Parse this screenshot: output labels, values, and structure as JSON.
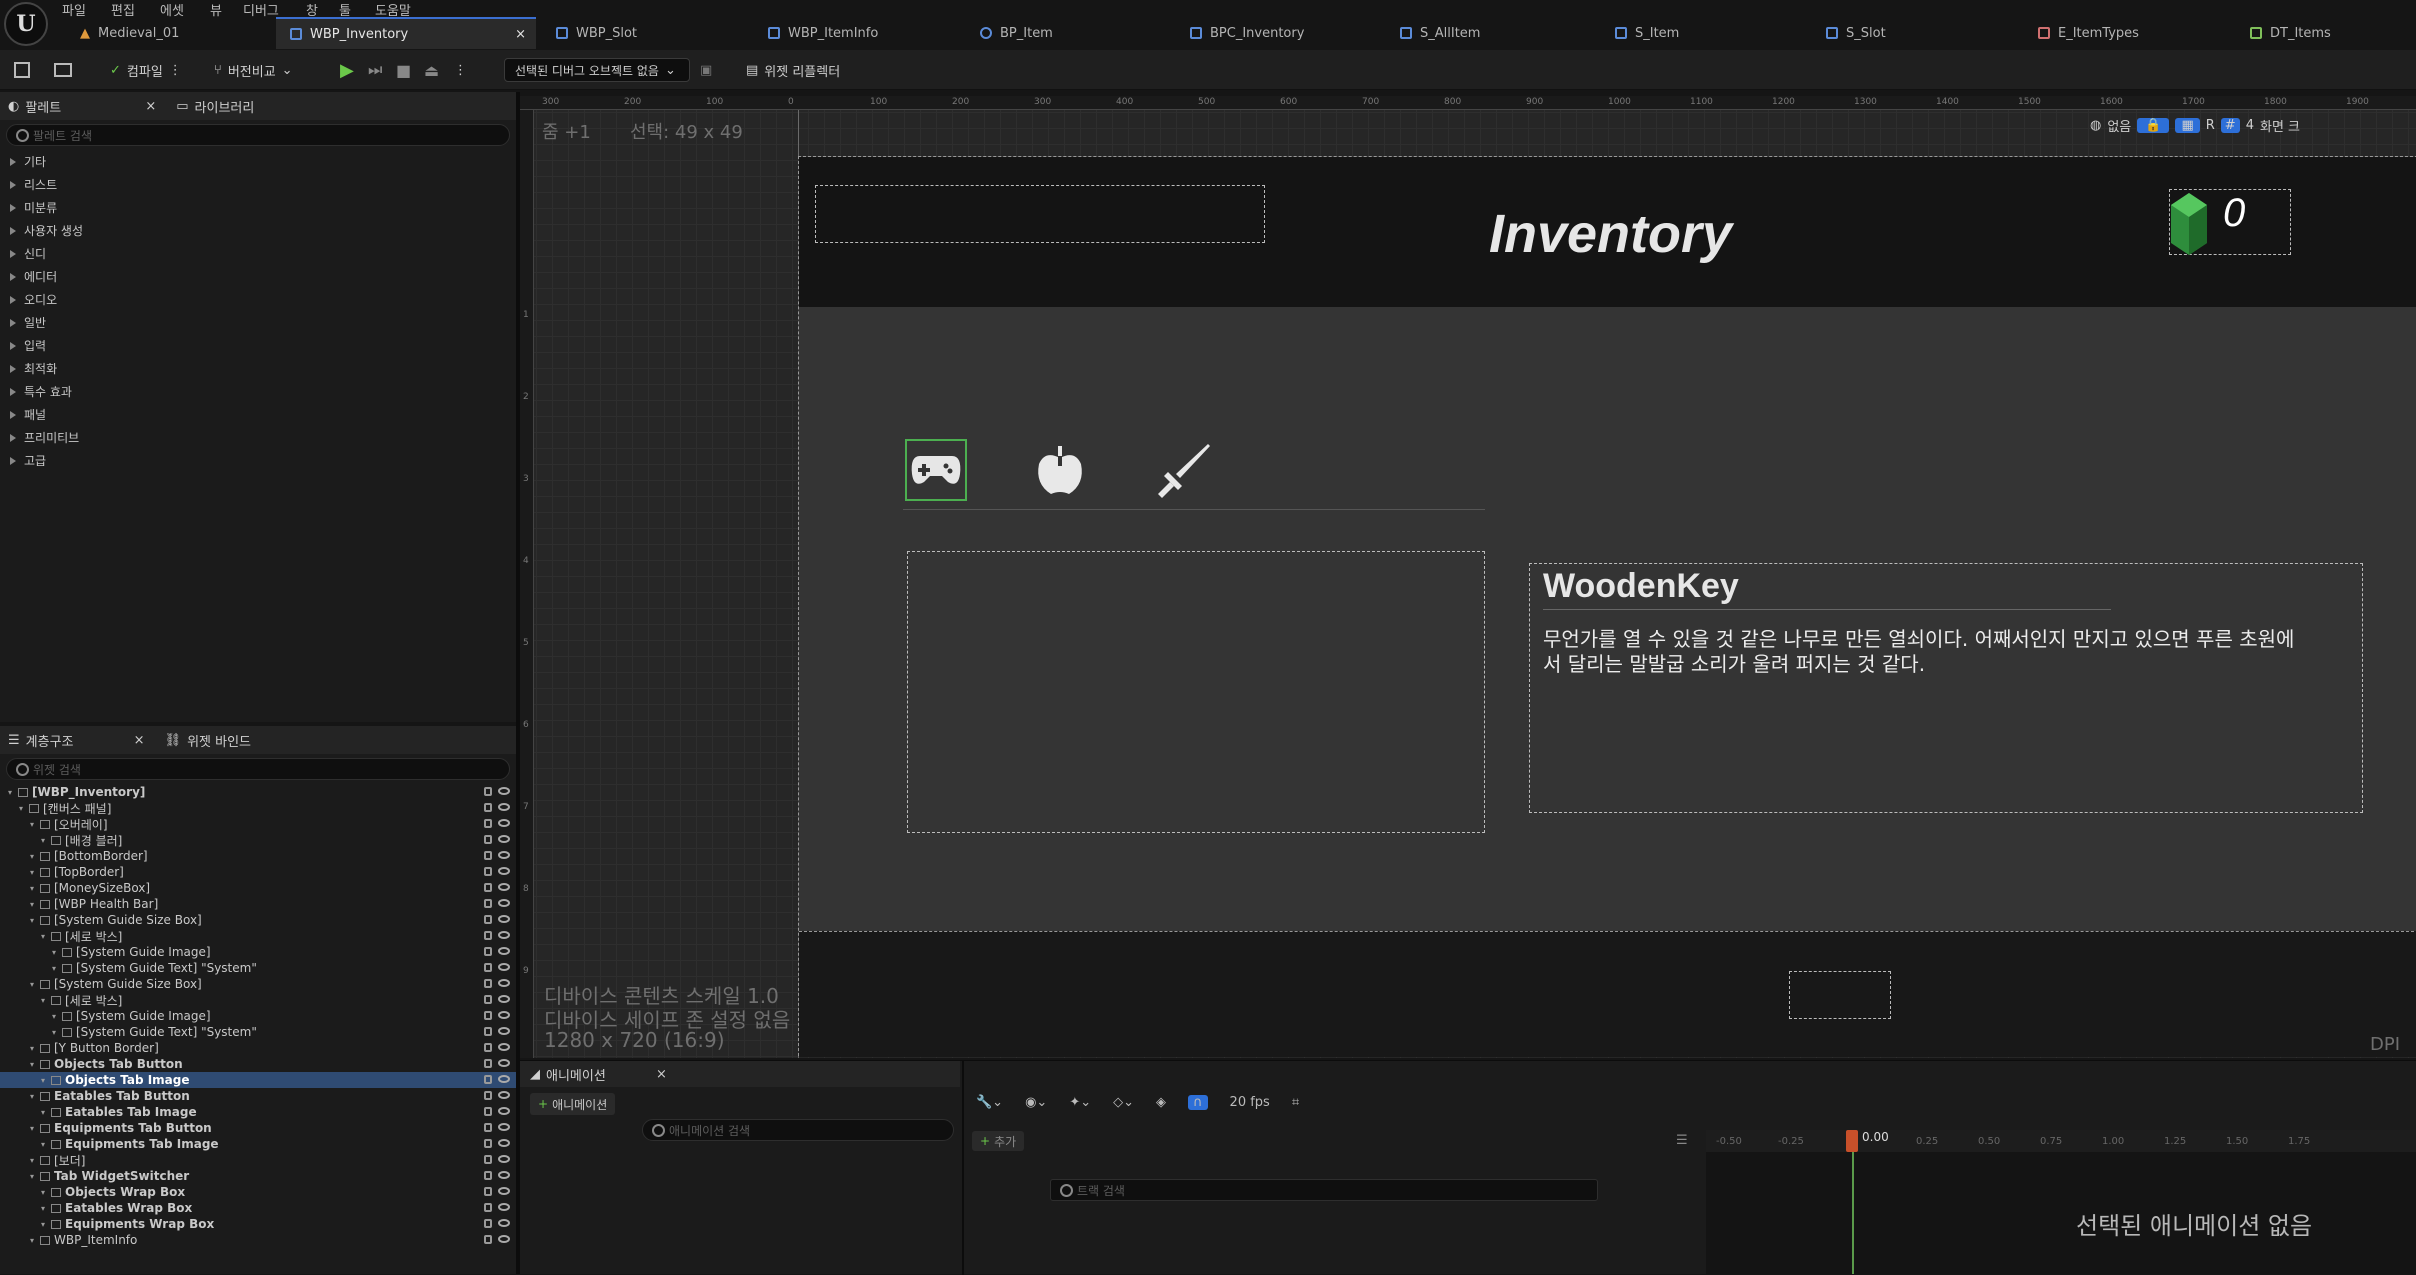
{
  "menu": [
    "파일",
    "편집",
    "에셋",
    "뷰",
    "디버그",
    "창",
    "툴",
    "도움말"
  ],
  "tabs": [
    {
      "label": "Medieval_01",
      "active": false
    },
    {
      "label": "WBP_Inventory",
      "active": true
    },
    {
      "label": "WBP_Slot",
      "active": false
    },
    {
      "label": "WBP_ItemInfo",
      "active": false
    },
    {
      "label": "BP_Item",
      "active": false
    },
    {
      "label": "BPC_Inventory",
      "active": false
    },
    {
      "label": "S_AllItem",
      "active": false
    },
    {
      "label": "S_Item",
      "active": false
    },
    {
      "label": "S_Slot",
      "active": false
    },
    {
      "label": "E_ItemTypes",
      "active": false
    },
    {
      "label": "DT_Items",
      "active": false
    }
  ],
  "toolbar": {
    "compile": "컴파일",
    "diff": "버전비교",
    "debug_object": "선택된 디버그 오브젝트 없음",
    "reflector": "위젯 리플렉터"
  },
  "palette": {
    "title": "팔레트",
    "library": "라이브러리",
    "search_placeholder": "팔레트 검색",
    "categories": [
      "기타",
      "리스트",
      "미분류",
      "사용자 생성",
      "신디",
      "에디터",
      "오디오",
      "일반",
      "입력",
      "최적화",
      "특수 효과",
      "패널",
      "프리미티브",
      "고급"
    ]
  },
  "hierarchy": {
    "title": "계층구조",
    "bindings": "위젯 바인드",
    "search_placeholder": "위젯 검색",
    "rows": [
      {
        "label": "[WBP_Inventory]",
        "indent": 0,
        "bold": true
      },
      {
        "label": "[캔버스 패널]",
        "indent": 1,
        "bold": false
      },
      {
        "label": "[오버레이]",
        "indent": 2,
        "bold": false
      },
      {
        "label": "[배경 블러]",
        "indent": 3,
        "bold": false
      },
      {
        "label": "[BottomBorder]",
        "indent": 2,
        "bold": false
      },
      {
        "label": "[TopBorder]",
        "indent": 2,
        "bold": false
      },
      {
        "label": "[MoneySizeBox]",
        "indent": 2,
        "bold": false
      },
      {
        "label": "[WBP Health Bar]",
        "indent": 2,
        "bold": false
      },
      {
        "label": "[System Guide Size Box]",
        "indent": 2,
        "bold": false
      },
      {
        "label": "[세로 박스]",
        "indent": 3,
        "bold": false
      },
      {
        "label": "[System Guide Image]",
        "indent": 4,
        "bold": false
      },
      {
        "label": "[System Guide Text] \"System\"",
        "indent": 4,
        "bold": false
      },
      {
        "label": "[System Guide Size Box]",
        "indent": 2,
        "bold": false
      },
      {
        "label": "[세로 박스]",
        "indent": 3,
        "bold": false
      },
      {
        "label": "[System Guide Image]",
        "indent": 4,
        "bold": false
      },
      {
        "label": "[System Guide Text] \"System\"",
        "indent": 4,
        "bold": false
      },
      {
        "label": "[Y Button Border]",
        "indent": 2,
        "bold": false
      },
      {
        "label": "Objects Tab Button",
        "indent": 2,
        "bold": true
      },
      {
        "label": "Objects Tab Image",
        "indent": 3,
        "bold": true,
        "selected": true
      },
      {
        "label": "Eatables Tab Button",
        "indent": 2,
        "bold": true
      },
      {
        "label": "Eatables Tab Image",
        "indent": 3,
        "bold": true
      },
      {
        "label": "Equipments Tab Button",
        "indent": 2,
        "bold": true
      },
      {
        "label": "Equipments Tab Image",
        "indent": 3,
        "bold": true
      },
      {
        "label": "[보더]",
        "indent": 2,
        "bold": false
      },
      {
        "label": "Tab WidgetSwitcher",
        "indent": 2,
        "bold": true
      },
      {
        "label": "Objects Wrap Box",
        "indent": 3,
        "bold": true
      },
      {
        "label": "Eatables Wrap Box",
        "indent": 3,
        "bold": true
      },
      {
        "label": "Equipments Wrap Box",
        "indent": 3,
        "bold": true
      },
      {
        "label": "WBP_ItemInfo",
        "indent": 2,
        "bold": false
      }
    ]
  },
  "canvas": {
    "zoom": "줌 +1",
    "selection": "선택: 49 x 49",
    "dpi": "DPI",
    "no_safezone": "없음",
    "screen": "화면 크",
    "device_scale": "디바이스 콘텐츠 스케일 1.0",
    "safe_zone": "디바이스 세이프 존 설정 없음",
    "resolution": "1280 x 720 (16:9)",
    "ruler_ticks": [
      "300",
      "200",
      "100",
      "0",
      "100",
      "200",
      "300",
      "400",
      "500",
      "600",
      "700",
      "800",
      "900",
      "1000",
      "1100",
      "1200",
      "1300",
      "1400",
      "1500",
      "1600",
      "1700",
      "1800",
      "1900"
    ],
    "ruler_left": [
      "1",
      "2",
      "3",
      "4",
      "5",
      "6",
      "7",
      "8",
      "9"
    ]
  },
  "widget": {
    "title": "Inventory",
    "money": "0",
    "item_name": "WoodenKey",
    "item_desc": "무언가를 열 수 있을 것 같은 나무로 만든 열쇠이다. 어째서인지 만지고 있으면 푸른 초원에서 달리는 말발굽 소리가 울려 퍼지는 것 같다."
  },
  "animation": {
    "title": "애니메이션",
    "add": "애니메이션",
    "search_placeholder": "애니메이션 검색",
    "add_track": "추가",
    "track_search": "트랙 검색",
    "fps": "20 fps",
    "time": "0.00",
    "no_anim": "선택된 애니메이션 없음",
    "ticks": [
      "-0.50",
      "-0.25",
      "0.25",
      "0.50",
      "0.75",
      "1.00",
      "1.25",
      "1.50",
      "1.75"
    ]
  },
  "colors": {
    "accent": "#3b6fd1",
    "selected_tab": "#4caf50",
    "gem": "#3aa64a"
  }
}
